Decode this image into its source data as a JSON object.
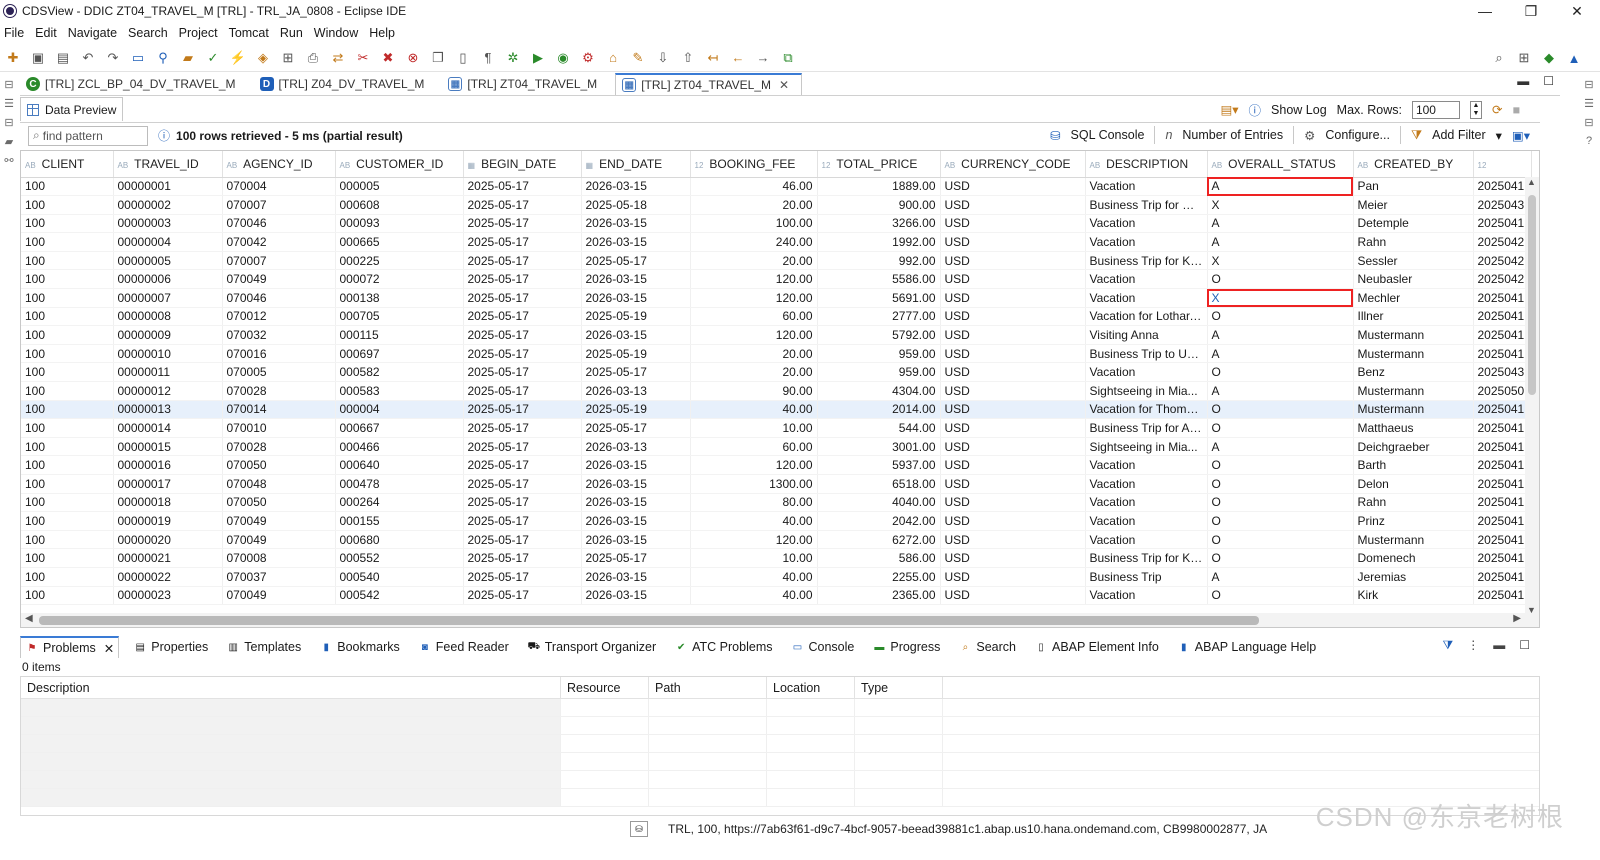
{
  "window": {
    "title": "CDSView - DDIC ZT04_TRAVEL_M [TRL] - TRL_JA_0808 - Eclipse IDE",
    "controls": [
      "—",
      "❐",
      "✕"
    ]
  },
  "menu": [
    "File",
    "Edit",
    "Navigate",
    "Search",
    "Project",
    "Tomcat",
    "Run",
    "Window",
    "Help"
  ],
  "editor_tabs": [
    {
      "label": "[TRL] ZCL_BP_04_DV_TRAVEL_M",
      "icon": "class-icon",
      "active": false
    },
    {
      "label": "[TRL] Z04_DV_TRAVEL_M",
      "icon": "ddl-icon",
      "active": false
    },
    {
      "label": "[TRL] ZT04_TRAVEL_M",
      "icon": "table-icon",
      "active": false
    },
    {
      "label": "[TRL] ZT04_TRAVEL_M",
      "icon": "table-icon",
      "active": true
    }
  ],
  "data_preview": {
    "tab_label": "Data Preview",
    "show_log": "Show Log",
    "max_rows_label": "Max. Rows:",
    "max_rows_value": "100",
    "find_placeholder": "find pattern",
    "status": "100 rows retrieved - 5 ms (partial result)",
    "sql_console": "SQL Console",
    "number_of_entries": "Number of Entries",
    "configure": "Configure...",
    "add_filter": "Add Filter"
  },
  "grid": {
    "columns": [
      "CLIENT",
      "TRAVEL_ID",
      "AGENCY_ID",
      "CUSTOMER_ID",
      "BEGIN_DATE",
      "END_DATE",
      "BOOKING_FEE",
      "TOTAL_PRICE",
      "CURRENCY_CODE",
      "DESCRIPTION",
      "OVERALL_STATUS",
      "CREATED_BY",
      ""
    ],
    "column_type_icons": [
      "AB",
      "AB",
      "AB",
      "AB",
      "▦",
      "▦",
      "12",
      "12",
      "AB",
      "AB",
      "AB",
      "AB",
      "12"
    ],
    "rows": [
      [
        "100",
        "00000001",
        "070004",
        "000005",
        "2025-05-17",
        "2026-03-15",
        "46.00",
        "1889.00",
        "USD",
        "Vacation",
        "A",
        "Pan",
        "2025041"
      ],
      [
        "100",
        "00000002",
        "070007",
        "000608",
        "2025-05-17",
        "2025-05-18",
        "20.00",
        "900.00",
        "USD",
        "Business Trip for Ch...",
        "X",
        "Meier",
        "2025043"
      ],
      [
        "100",
        "00000003",
        "070046",
        "000093",
        "2025-05-17",
        "2026-03-15",
        "100.00",
        "3266.00",
        "USD",
        "Vacation",
        "A",
        "Detemple",
        "2025041"
      ],
      [
        "100",
        "00000004",
        "070042",
        "000665",
        "2025-05-17",
        "2026-03-15",
        "240.00",
        "1992.00",
        "USD",
        "Vacation",
        "A",
        "Rahn",
        "2025042"
      ],
      [
        "100",
        "00000005",
        "070007",
        "000225",
        "2025-05-17",
        "2025-05-17",
        "20.00",
        "992.00",
        "USD",
        "Business Trip for Ku...",
        "X",
        "Sessler",
        "2025042"
      ],
      [
        "100",
        "00000006",
        "070049",
        "000072",
        "2025-05-17",
        "2026-03-15",
        "120.00",
        "5586.00",
        "USD",
        "Vacation",
        "O",
        "Neubasler",
        "2025042"
      ],
      [
        "100",
        "00000007",
        "070046",
        "000138",
        "2025-05-17",
        "2026-03-15",
        "120.00",
        "5691.00",
        "USD",
        "Vacation",
        "X",
        "Mechler",
        "2025041"
      ],
      [
        "100",
        "00000008",
        "070012",
        "000705",
        "2025-05-17",
        "2025-05-19",
        "60.00",
        "2777.00",
        "USD",
        "Vacation for Lothar,...",
        "O",
        "Illner",
        "2025041"
      ],
      [
        "100",
        "00000009",
        "070032",
        "000115",
        "2025-05-17",
        "2026-03-15",
        "120.00",
        "5792.00",
        "USD",
        "Visiting Anna",
        "A",
        "Mustermann",
        "2025041"
      ],
      [
        "100",
        "00000010",
        "070016",
        "000697",
        "2025-05-17",
        "2025-05-19",
        "20.00",
        "959.00",
        "USD",
        "Business Trip to USA",
        "A",
        "Mustermann",
        "2025041"
      ],
      [
        "100",
        "00000011",
        "070005",
        "000582",
        "2025-05-17",
        "2025-05-17",
        "20.00",
        "959.00",
        "USD",
        "Vacation",
        "O",
        "Benz",
        "2025043"
      ],
      [
        "100",
        "00000012",
        "070028",
        "000583",
        "2025-05-17",
        "2026-03-13",
        "90.00",
        "4304.00",
        "USD",
        "Sightseeing in Mia...",
        "A",
        "Mustermann",
        "2025050"
      ],
      [
        "100",
        "00000013",
        "070014",
        "000004",
        "2025-05-17",
        "2025-05-19",
        "40.00",
        "2014.00",
        "USD",
        "Vacation for Thoma...",
        "O",
        "Mustermann",
        "2025041"
      ],
      [
        "100",
        "00000014",
        "070010",
        "000667",
        "2025-05-17",
        "2025-05-17",
        "10.00",
        "544.00",
        "USD",
        "Business Trip for An...",
        "O",
        "Matthaeus",
        "2025041"
      ],
      [
        "100",
        "00000015",
        "070028",
        "000466",
        "2025-05-17",
        "2026-03-13",
        "60.00",
        "3001.00",
        "USD",
        "Sightseeing in Mia...",
        "A",
        "Deichgraeber",
        "2025041"
      ],
      [
        "100",
        "00000016",
        "070050",
        "000640",
        "2025-05-17",
        "2026-03-15",
        "120.00",
        "5937.00",
        "USD",
        "Vacation",
        "O",
        "Barth",
        "2025041"
      ],
      [
        "100",
        "00000017",
        "070048",
        "000478",
        "2025-05-17",
        "2026-03-15",
        "1300.00",
        "6518.00",
        "USD",
        "Vacation",
        "O",
        "Delon",
        "2025041"
      ],
      [
        "100",
        "00000018",
        "070050",
        "000264",
        "2025-05-17",
        "2026-03-15",
        "80.00",
        "4040.00",
        "USD",
        "Vacation",
        "O",
        "Rahn",
        "2025041"
      ],
      [
        "100",
        "00000019",
        "070049",
        "000155",
        "2025-05-17",
        "2026-03-15",
        "40.00",
        "2042.00",
        "USD",
        "Vacation",
        "O",
        "Prinz",
        "2025041"
      ],
      [
        "100",
        "00000020",
        "070049",
        "000680",
        "2025-05-17",
        "2026-03-15",
        "120.00",
        "6272.00",
        "USD",
        "Vacation",
        "O",
        "Mustermann",
        "2025041"
      ],
      [
        "100",
        "00000021",
        "070008",
        "000552",
        "2025-05-17",
        "2025-05-17",
        "10.00",
        "586.00",
        "USD",
        "Business Trip for Kri...",
        "O",
        "Domenech",
        "2025041"
      ],
      [
        "100",
        "00000022",
        "070037",
        "000540",
        "2025-05-17",
        "2026-03-15",
        "40.00",
        "2255.00",
        "USD",
        "Business Trip",
        "A",
        "Jeremias",
        "2025041"
      ],
      [
        "100",
        "00000023",
        "070049",
        "000542",
        "2025-05-17",
        "2026-03-15",
        "40.00",
        "2365.00",
        "USD",
        "Vacation",
        "O",
        "Kirk",
        "2025041"
      ]
    ],
    "selected_row": 12,
    "highlighted_rows": [
      0,
      6
    ]
  },
  "bottom_tabs": [
    "Problems",
    "Properties",
    "Templates",
    "Bookmarks",
    "Feed Reader",
    "Transport Organizer",
    "ATC Problems",
    "Console",
    "Progress",
    "Search",
    "ABAP Element Info",
    "ABAP Language Help"
  ],
  "problems": {
    "count": "0 items",
    "columns": [
      "Description",
      "Resource",
      "Path",
      "Location",
      "Type"
    ]
  },
  "statusbar": {
    "connection": "TRL, 100, https://7ab63f61-d9c7-4bcf-9057-beead39881c1.abap.us10.hana.ondemand.com, CB9980002877, JA"
  },
  "watermark": "CSDN @东京老树根",
  "colors": {
    "accent": "#3a7bd5",
    "highlight_box": "#e22222",
    "selected_row": "#e7f0fb"
  }
}
